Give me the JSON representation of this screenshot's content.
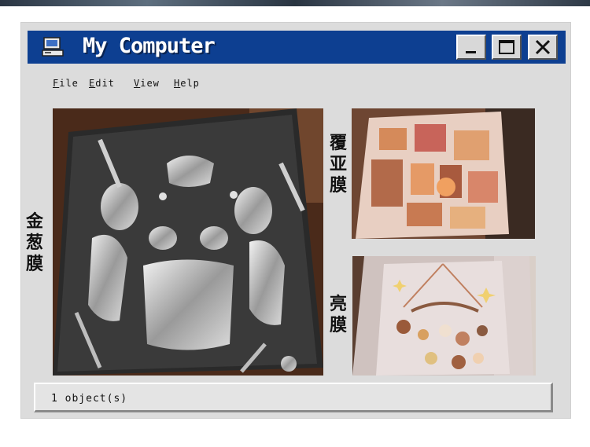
{
  "window": {
    "title": "My Computer",
    "icon": "computer-icon",
    "controls": {
      "minimize": "minimize-icon",
      "maximize": "maximize-icon",
      "close": "close-icon"
    }
  },
  "menu": {
    "file": {
      "accel": "F",
      "rest": "ile"
    },
    "edit": {
      "accel": "E",
      "rest": "dit"
    },
    "view": {
      "accel": "V",
      "rest": "iew"
    },
    "help": {
      "accel": "H",
      "rest": "elp"
    }
  },
  "labels": {
    "left": "金葱膜",
    "top_right": "覆亚膜",
    "bottom_right": "亮膜"
  },
  "status": {
    "text": "1 object(s)"
  },
  "colors": {
    "titlebar": "#0d3f91",
    "window_bg": "#dcdcdc"
  }
}
